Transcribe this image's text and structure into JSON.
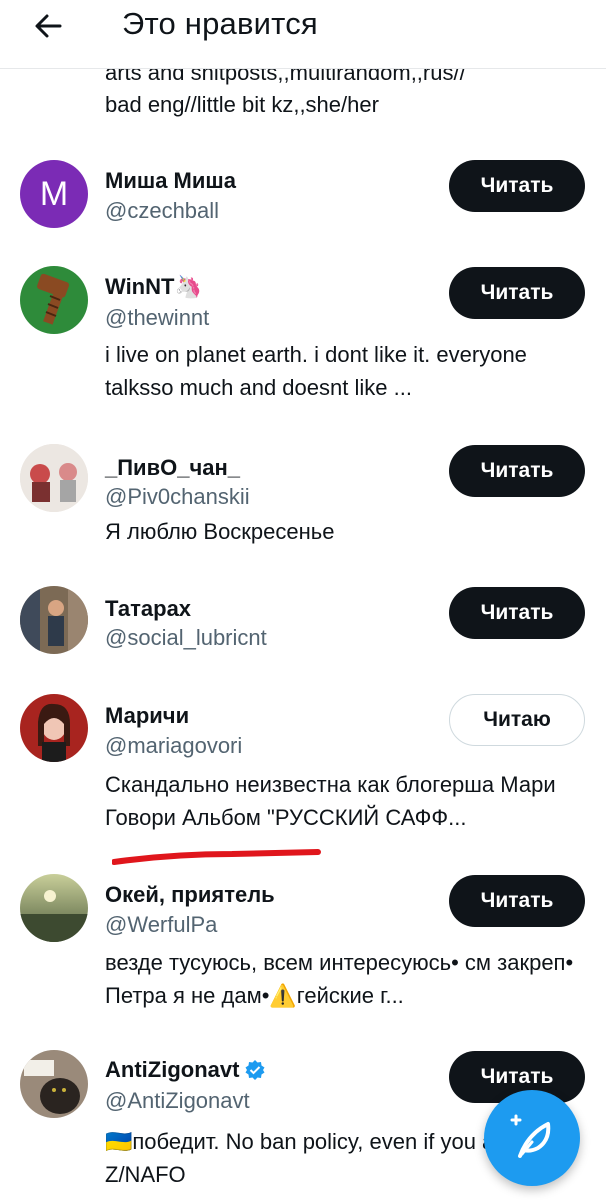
{
  "header": {
    "title": "Это нравится"
  },
  "top_bio": {
    "line1": "arts and shitposts,,multirandom,,rus//",
    "line2": "bad eng//little bit kz,,she/her"
  },
  "users": [
    {
      "name": "Миша Миша",
      "handle": "@czechball",
      "bio": "",
      "button": "Читать",
      "avatar_letter": "M",
      "avatar_color": "#7b2bb5"
    },
    {
      "name": "WinNT🦄",
      "handle": "@thewinnt",
      "bio": "i live on planet earth. i dont like it. everyone talksso much and doesnt like ...",
      "button": "Читать",
      "avatar_color": "#2e8b3a"
    },
    {
      "name": "_ПивО_чан_",
      "handle": "@Piv0chanskii",
      "bio": "Я люблю Воскресенье",
      "button": "Читать"
    },
    {
      "name": "Татарах",
      "handle": "@social_lubricnt",
      "bio": "",
      "button": "Читать"
    },
    {
      "name": "Маричи",
      "handle": "@mariagovori",
      "bio": "Скандально неизвестна как блогерша Мари Говори Альбом \"РУССКИЙ САФФ...",
      "button": "Читаю"
    },
    {
      "name": "Окей, приятель",
      "handle": "@WerfulPa",
      "bio": "везде тусуюсь, всем интересуюсь• см закреп• Петра я не дам•⚠️гейские г...",
      "button": "Читать"
    },
    {
      "name": "AntiZigonavt",
      "handle": "@AntiZigonavt",
      "bio": "🇺🇦победит. No ban policy, even if you are Z/NAFO",
      "button": "Читать"
    }
  ],
  "colors": {
    "accent": "#1d9bf0",
    "annotation": "#e0161c",
    "text": "#0f1419",
    "secondary": "#536471"
  },
  "icons": {
    "back": "arrow-left-icon",
    "verified": "verified-badge-icon",
    "compose": "compose-post-icon"
  }
}
